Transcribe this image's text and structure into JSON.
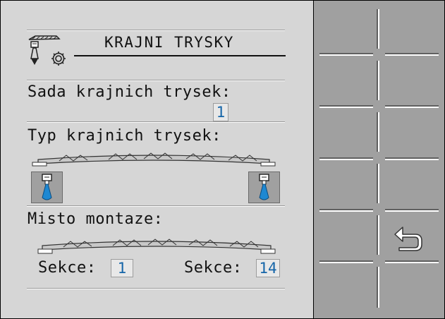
{
  "header": {
    "title": "KRAJNI TRYSKY",
    "icons": [
      "boom-nozzle-icon",
      "gear-icon"
    ]
  },
  "nozzle_set": {
    "label": "Sada krajnich trysek:",
    "value": "1"
  },
  "nozzle_type": {
    "label": "Typ krajnich trysek:",
    "left_nozzle": "nozzle-icon",
    "right_nozzle": "nozzle-icon"
  },
  "mounting": {
    "label": "Misto montaze:",
    "left_label": "Sekce:",
    "left_value": "1",
    "right_label": "Sekce:",
    "right_value": "14"
  },
  "softkeys": {
    "return_icon": "return-arrow-icon"
  },
  "colors": {
    "panel": "#d6d6d6",
    "softkey_panel": "#a0a0a0",
    "value_text": "#1565a8",
    "nozzle_blue": "#1e88d2"
  }
}
